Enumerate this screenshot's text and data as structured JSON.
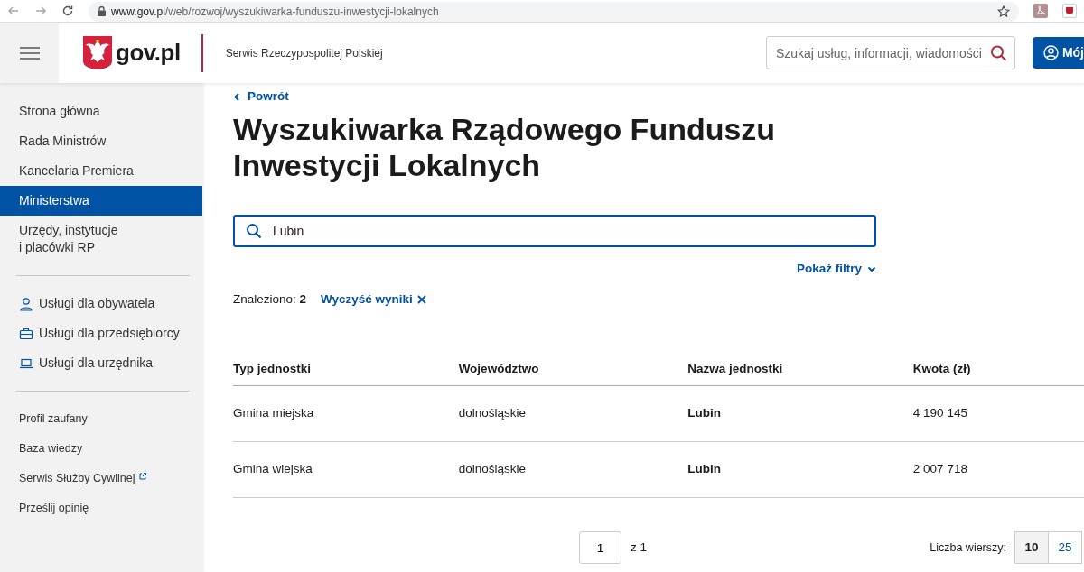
{
  "browser": {
    "url_host": "www.gov.pl",
    "url_path": "/web/rozwoj/wyszukiwarka-funduszu-inwestycji-lokalnych"
  },
  "header": {
    "logo_text": "gov.pl",
    "service_name": "Serwis Rzeczypospolitej Polskiej",
    "search": {
      "placeholder": "Szukaj usług, informacji, wiadomości"
    },
    "account_button": "Mój"
  },
  "sidebar": {
    "main_items": [
      {
        "label": "Strona główna",
        "selected": false
      },
      {
        "label": "Rada Ministrów",
        "selected": false
      },
      {
        "label": "Kancelaria Premiera",
        "selected": false
      },
      {
        "label": "Ministerstwa",
        "selected": true
      },
      {
        "label": "Urzędy, instytucje i placówki RP",
        "selected": false
      }
    ],
    "services": [
      {
        "label": "Usługi dla obywatela",
        "kind": "person"
      },
      {
        "label": "Usługi dla przedsiębiorcy",
        "kind": "briefcase"
      },
      {
        "label": "Usługi dla urzędnika",
        "kind": "laptop"
      }
    ],
    "links": [
      {
        "label": "Profil zaufany",
        "external": false
      },
      {
        "label": "Baza wiedzy",
        "external": false
      },
      {
        "label": "Serwis Służby Cywilnej",
        "external": true
      },
      {
        "label": "Prześlij opinię",
        "external": false
      }
    ]
  },
  "main": {
    "back_link": "Powrót",
    "title": "Wyszukiwarka Rządowego Funduszu Inwestycji Lokalnych",
    "search": {
      "value": "Lubin"
    },
    "filters_toggle": "Pokaż filtry",
    "found_label": "Znaleziono:",
    "found_count": "2",
    "clear_results": "Wyczyść wyniki",
    "table": {
      "columns": [
        "Typ jednostki",
        "Województwo",
        "Nazwa jednostki",
        "Kwota (zł)"
      ],
      "rows": [
        [
          "Gmina miejska",
          "dolnośląskie",
          "Lubin",
          "4 190 145"
        ],
        [
          "Gmina wiejska",
          "dolnośląskie",
          "Lubin",
          "2 007 718"
        ]
      ]
    },
    "pagination": {
      "page": "1",
      "of_label": "z 1",
      "rows_label": "Liczba wierszy:",
      "page_sizes": [
        {
          "label": "10",
          "selected": true
        },
        {
          "label": "25",
          "selected": false
        }
      ]
    }
  }
}
